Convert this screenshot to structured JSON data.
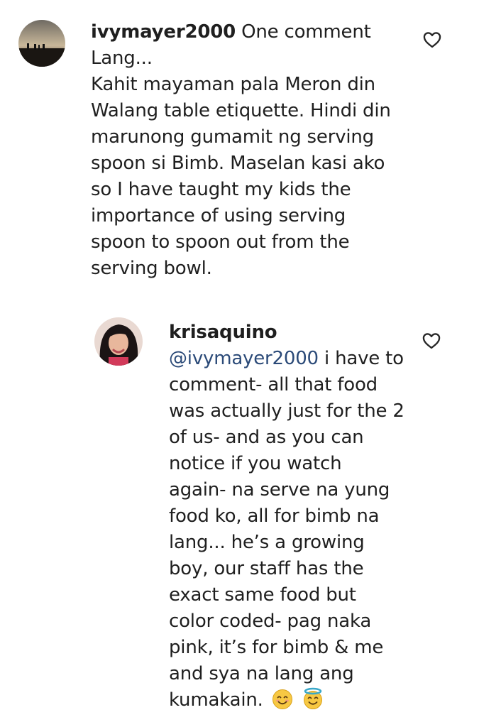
{
  "comment": {
    "username": "ivymayer2000",
    "lines": [
      "One comment",
      "Lang...",
      "Kahit mayaman pala Meron din",
      "Walang table etiquette. Hindi din",
      "marunong gumamit ng serving",
      "spoon si Bimb. Maselan kasi ako",
      "so I have taught my kids the",
      "importance of using serving",
      "spoon to spoon out from the",
      "serving bowl."
    ]
  },
  "reply": {
    "username": "krisaquino",
    "mention": "@ivymayer2000",
    "lines": [
      "i have to",
      "comment- all that food",
      "was actually just for the 2",
      "of us- and as you can",
      "notice if you watch",
      "again- na serve na yung",
      "food ko, all for bimb na",
      "lang... he’s a growing",
      "boy, our staff has the",
      "exact same food but",
      "color coded- pag naka",
      "pink, it’s for bimb & me",
      "and sya na lang ang",
      "kumakain."
    ],
    "emojis": [
      "smiling-face-emoji",
      "smiling-face-with-halo-emoji"
    ]
  },
  "icons": {
    "like": "heart-outline-icon"
  }
}
